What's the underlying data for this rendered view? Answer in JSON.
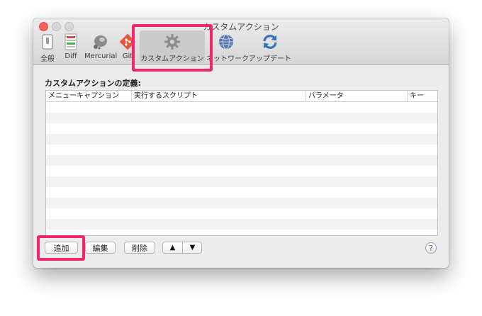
{
  "window": {
    "title": "カスタムアクション"
  },
  "toolbar": {
    "items": [
      {
        "label": "全般",
        "icon": "switch-icon"
      },
      {
        "label": "Diff",
        "icon": "diff-icon"
      },
      {
        "label": "Mercurial",
        "icon": "mercurial-icon"
      },
      {
        "label": "Git",
        "icon": "git-icon"
      },
      {
        "label": "カスタムアクション",
        "icon": "gear-icon",
        "selected": true
      },
      {
        "label": "ネットワーク",
        "icon": "globe-icon"
      },
      {
        "label": "アップデート",
        "icon": "refresh-icon"
      }
    ]
  },
  "section": {
    "title": "カスタムアクションの定義:"
  },
  "table": {
    "columns": [
      "メニューキャプション",
      "実行するスクリプト",
      "パラメータ",
      "キー"
    ],
    "rows": []
  },
  "buttons": {
    "add": "追加",
    "edit": "編集",
    "delete": "削除",
    "move_up": "▲",
    "move_down": "▼",
    "help": "?"
  },
  "colors": {
    "highlight": "#f0266e",
    "close_button": "#fc605c",
    "selected_toolbar": "#cbcbcb"
  }
}
